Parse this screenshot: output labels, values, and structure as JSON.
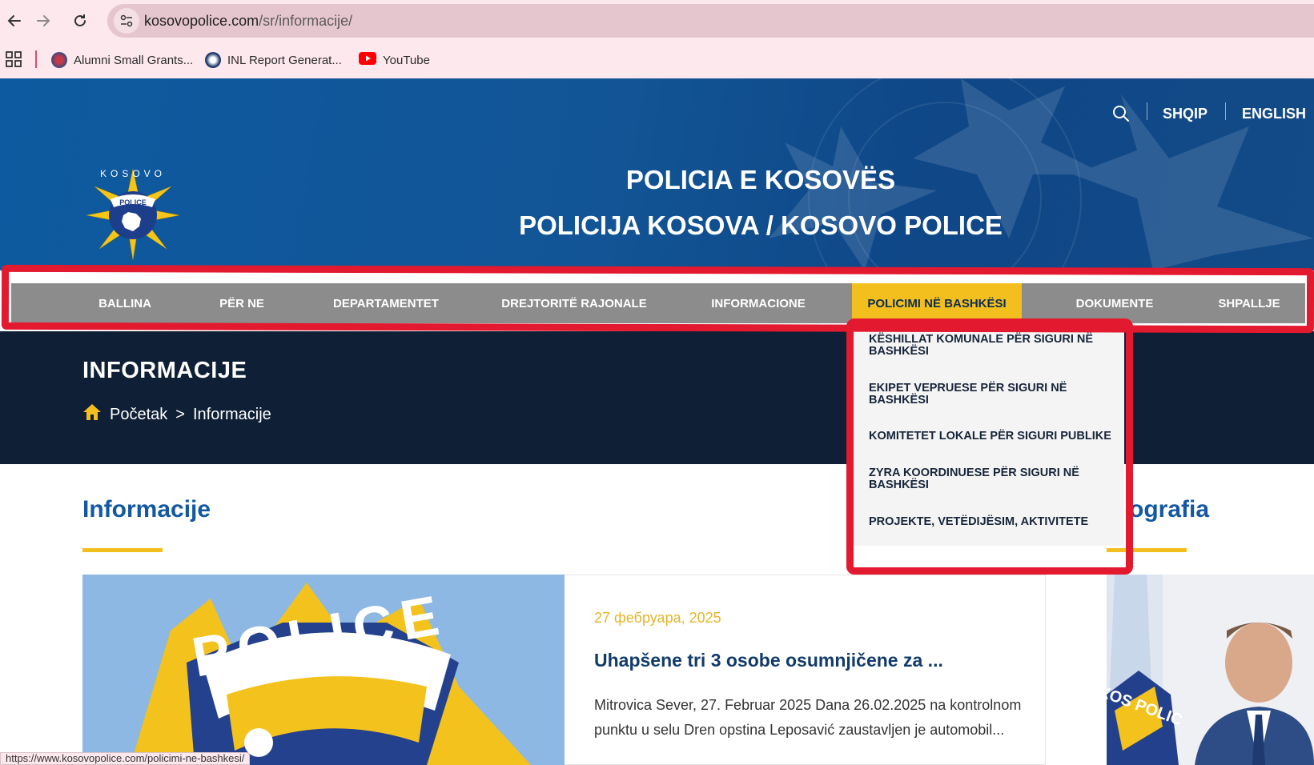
{
  "browser": {
    "url_host": "kosovopolice.com",
    "url_path": "/sr/informacije/",
    "bookmarks": [
      {
        "label": "Alumni Small Grants...",
        "icon": "alumni-favicon"
      },
      {
        "label": "INL Report Generat...",
        "icon": "inl-favicon"
      },
      {
        "label": "YouTube",
        "icon": "youtube-favicon"
      }
    ],
    "status_url": "https://www.kosovopolice.com/policimi-ne-bashkesi/"
  },
  "header": {
    "title_line1": "POLICIA E KOSOVËS",
    "title_line2": "POLICIJA KOSOVA / KOSOVO POLICE",
    "languages": [
      "SHQIP",
      "ENGLISH"
    ],
    "logo_text": "KOSOVO",
    "logo_badge": "POLICE"
  },
  "menu": {
    "items": [
      {
        "label": "BALLINA"
      },
      {
        "label": "PËR NE"
      },
      {
        "label": "DEPARTAMENTET"
      },
      {
        "label": "DREJTORITË RAJONALE"
      },
      {
        "label": "INFORMACIONE"
      },
      {
        "label": "POLICIMI NË BASHKËSI"
      },
      {
        "label": "DOKUMENTE"
      },
      {
        "label": "SHPALLJE"
      }
    ],
    "active_index": 5,
    "dropdown": [
      {
        "label": "KËSHILLAT KOMUNALE PËR SIGURI NË BASHKËSI"
      },
      {
        "label": "EKIPET VEPRUESE PËR SIGURI NË BASHKËSI"
      },
      {
        "label": "KOMITETET LOKALE PËR SIGURI PUBLIKE"
      },
      {
        "label": "ZYRA KOORDINUESE PËR SIGURI NË BASHKËSI"
      },
      {
        "label": "PROJEKTE, VETËDIJËSIM, AKTIVITETE"
      }
    ]
  },
  "page": {
    "heading": "INFORMACIJE",
    "breadcrumb_home": "Početak",
    "breadcrumb_sep": ">",
    "breadcrumb_current": "Informacije"
  },
  "content": {
    "section_title": "Informacije",
    "side_title": "ografia",
    "post": {
      "image_text": "POLICE",
      "date": "27 фебруара, 2025",
      "title": "Uhapšene tri 3 osobe osumnjičene za ...",
      "excerpt": "Mitrovica Sever, 27. Februar 2025 Dana 26.02.2025 na kontrolnom punktu u selu Dren opstina Leposavić zaustavljen je automobil..."
    },
    "photo_badge_text": "KOS POLIC"
  },
  "colors": {
    "accent_yellow": "#f3bf1e",
    "brand_blue": "#1358a0",
    "highlight_red": "#e2192f",
    "banner_dark": "#0f2036",
    "menu_gray": "#8c8c8c"
  }
}
